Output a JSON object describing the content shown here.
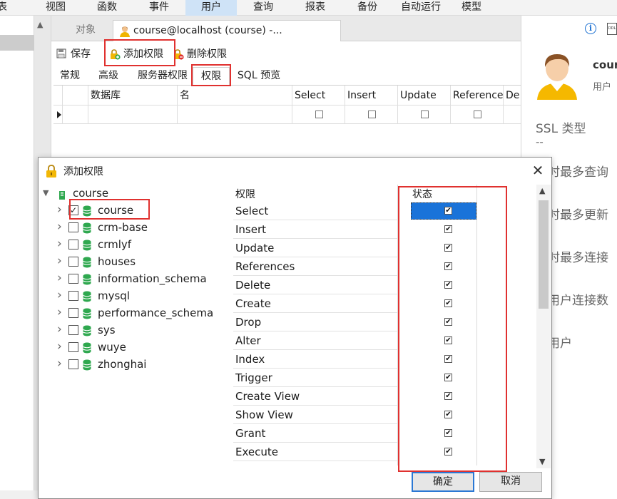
{
  "menu": [
    "表",
    "视图",
    "函数",
    "事件",
    "用户",
    "查询",
    "报表",
    "备份",
    "自动运行",
    "模型"
  ],
  "menu_active": "用户",
  "tabs": {
    "objects": "对象",
    "user_tab": "course@localhost (course) -..."
  },
  "toolbar": {
    "save": "保存",
    "add_priv": "添加权限",
    "del_priv": "删除权限"
  },
  "subtabs": [
    "常规",
    "高级",
    "服务器权限",
    "权限",
    "SQL 预览"
  ],
  "grid": {
    "columns": [
      "数据库",
      "名",
      "Select",
      "Insert",
      "Update",
      "Reference",
      "De"
    ]
  },
  "right_panel": {
    "user_name": "course",
    "user_role": "用户",
    "ssl_label": "SSL 类型",
    "ssl_value": "--",
    "max_queries": "小时最多查询",
    "max_updates": "小时最多更新",
    "max_connections": "小时最多连接",
    "max_user_connections": "多用户连接数",
    "super_user": "级用户"
  },
  "dialog": {
    "title": "添加权限",
    "root": "course",
    "databases": [
      {
        "name": "course",
        "checked": true
      },
      {
        "name": "crm-base",
        "checked": false
      },
      {
        "name": "crmlyf",
        "checked": false
      },
      {
        "name": "houses",
        "checked": false
      },
      {
        "name": "information_schema",
        "checked": false
      },
      {
        "name": "mysql",
        "checked": false
      },
      {
        "name": "performance_schema",
        "checked": false
      },
      {
        "name": "sys",
        "checked": false
      },
      {
        "name": "wuye",
        "checked": false
      },
      {
        "name": "zhonghai",
        "checked": false
      }
    ],
    "priv_header": "权限",
    "status_header": "状态",
    "privileges": [
      "Select",
      "Insert",
      "Update",
      "References",
      "Delete",
      "Create",
      "Drop",
      "Alter",
      "Index",
      "Trigger",
      "Create View",
      "Show View",
      "Grant",
      "Execute"
    ],
    "ok": "确定",
    "cancel": "取消"
  },
  "colors": {
    "accent": "#1a73d9",
    "highlight_red": "#e0312f",
    "db_green": "#2fa84f"
  }
}
